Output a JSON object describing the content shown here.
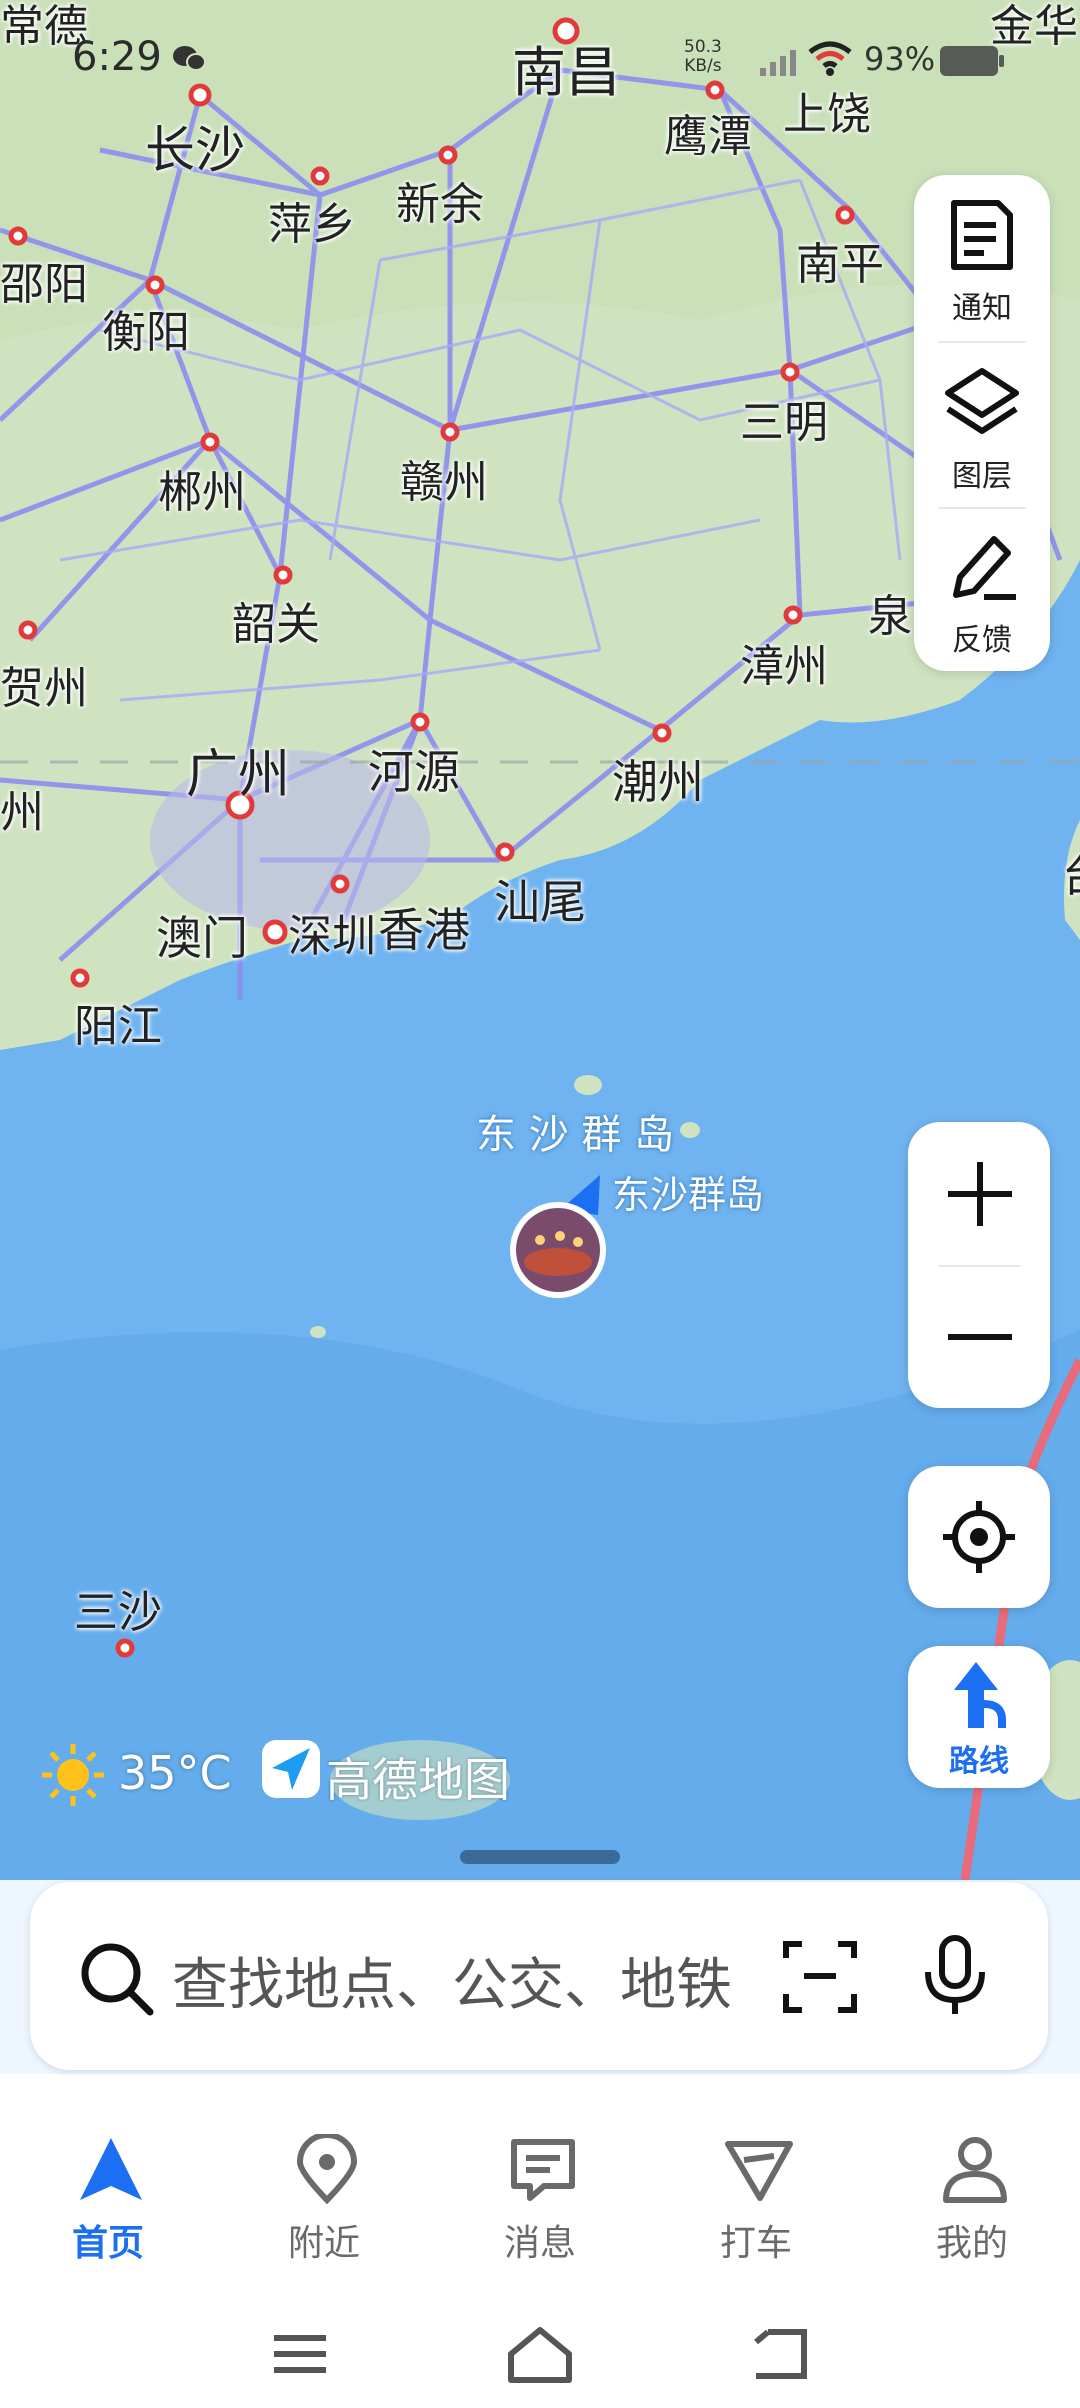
{
  "status_bar": {
    "time": "6:29",
    "net_speed_value": "50.3",
    "net_speed_unit": "KB/s",
    "battery_pct": "93%"
  },
  "map": {
    "city_labels": [
      {
        "name": "常德"
      },
      {
        "name": "南昌"
      },
      {
        "name": "金华"
      },
      {
        "name": "长沙"
      },
      {
        "name": "鹰潭"
      },
      {
        "name": "上饶"
      },
      {
        "name": "萍乡"
      },
      {
        "name": "新余"
      },
      {
        "name": "南平"
      },
      {
        "name": "衡阳"
      },
      {
        "name": "邵阳"
      },
      {
        "name": "三明"
      },
      {
        "name": "郴州"
      },
      {
        "name": "赣州"
      },
      {
        "name": "韶关"
      },
      {
        "name": "泉"
      },
      {
        "name": "贺州"
      },
      {
        "name": "漳州"
      },
      {
        "name": "广州"
      },
      {
        "name": "河源"
      },
      {
        "name": "潮州"
      },
      {
        "name": "汕尾"
      },
      {
        "name": "澳门"
      },
      {
        "name": "深圳"
      },
      {
        "name": "香港"
      },
      {
        "name": "阳江"
      },
      {
        "name": "三沙"
      },
      {
        "name": "台"
      },
      {
        "name": "州"
      }
    ],
    "island_label": "东 沙 群 岛",
    "poi_label": "东沙群岛"
  },
  "toolbar": {
    "notice": "通知",
    "layers": "图层",
    "feedback": "反馈"
  },
  "route_label": "路线",
  "weather": {
    "temp": "35°C"
  },
  "brand": "高德地图",
  "search": {
    "placeholder": "查找地点、公交、地铁"
  },
  "nav": [
    {
      "label": "首页"
    },
    {
      "label": "附近"
    },
    {
      "label": "消息"
    },
    {
      "label": "打车"
    },
    {
      "label": "我的"
    }
  ],
  "colors": {
    "accent": "#1c6ef2",
    "sea": "#6fb3f0",
    "land": "#cfe3c0",
    "road": "#8c8ef0",
    "marker": "#e23a3a"
  }
}
